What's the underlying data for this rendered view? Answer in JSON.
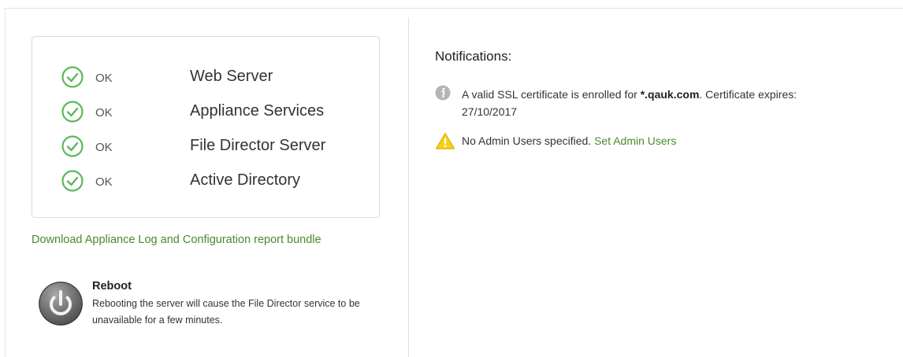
{
  "status_panel": {
    "items": [
      {
        "status": "OK",
        "service": "Web Server",
        "icon": "check-circle-icon"
      },
      {
        "status": "OK",
        "service": "Appliance Services",
        "icon": "check-circle-icon"
      },
      {
        "status": "OK",
        "service": "File Director Server",
        "icon": "check-circle-icon"
      },
      {
        "status": "OK",
        "service": "Active Directory",
        "icon": "check-circle-icon"
      }
    ]
  },
  "download_link": "Download Appliance Log and Configuration report bundle",
  "reboot": {
    "title": "Reboot",
    "description": "Rebooting the server will cause the File Director service to be unavailable for a few minutes.",
    "icon": "power-icon"
  },
  "notifications": {
    "title": "Notifications:",
    "info": {
      "icon": "info-icon",
      "prefix": "A valid SSL certificate is enrolled for ",
      "domain": "*.qauk.com",
      "suffix": ". Certificate expires: 27/10/2017"
    },
    "warning": {
      "icon": "warning-icon",
      "text": "No Admin Users specified. ",
      "link": "Set Admin Users"
    }
  },
  "colors": {
    "ok_green": "#5cb85c",
    "link_green": "#4a8a2a",
    "warning_yellow": "#f2c200"
  }
}
